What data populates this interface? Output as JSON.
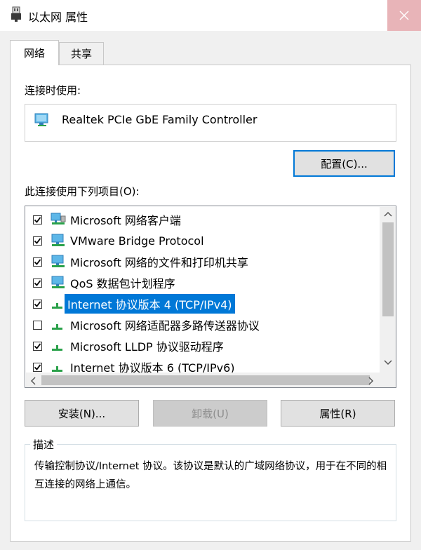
{
  "window": {
    "title": "以太网 属性",
    "close_icon": "close-x-icon"
  },
  "tabs": [
    {
      "label": "网络",
      "active": true
    },
    {
      "label": "共享",
      "active": false
    }
  ],
  "connect_using_label": "连接时使用:",
  "adapter_name": "Realtek PCIe GbE Family Controller",
  "configure_button": "配置(C)...",
  "items_label": "此连接使用下列项目(O):",
  "items": [
    {
      "label": "Microsoft 网络客户端",
      "checked": true,
      "icon": "network-client-icon"
    },
    {
      "label": "VMware Bridge Protocol",
      "checked": true,
      "icon": "network-service-icon"
    },
    {
      "label": "Microsoft 网络的文件和打印机共享",
      "checked": true,
      "icon": "network-service-icon"
    },
    {
      "label": "QoS 数据包计划程序",
      "checked": true,
      "icon": "network-service-icon"
    },
    {
      "label": "Internet 协议版本 4 (TCP/IPv4)",
      "checked": true,
      "selected": true,
      "icon": "protocol-icon"
    },
    {
      "label": "Microsoft 网络适配器多路传送器协议",
      "checked": false,
      "icon": "protocol-icon"
    },
    {
      "label": "Microsoft LLDP 协议驱动程序",
      "checked": true,
      "icon": "protocol-icon"
    },
    {
      "label": "Internet 协议版本 6 (TCP/IPv6)",
      "checked": true,
      "icon": "protocol-icon"
    }
  ],
  "buttons": {
    "install": "安装(N)...",
    "uninstall": "卸载(U)",
    "properties": "属性(R)"
  },
  "description": {
    "title": "描述",
    "text": "传输控制协议/Internet 协议。该协议是默认的广域网络协议，用于在不同的相互连接的网络上通信。"
  },
  "colors": {
    "selection": "#0078d7",
    "close_hover": "#e8b4b8"
  }
}
